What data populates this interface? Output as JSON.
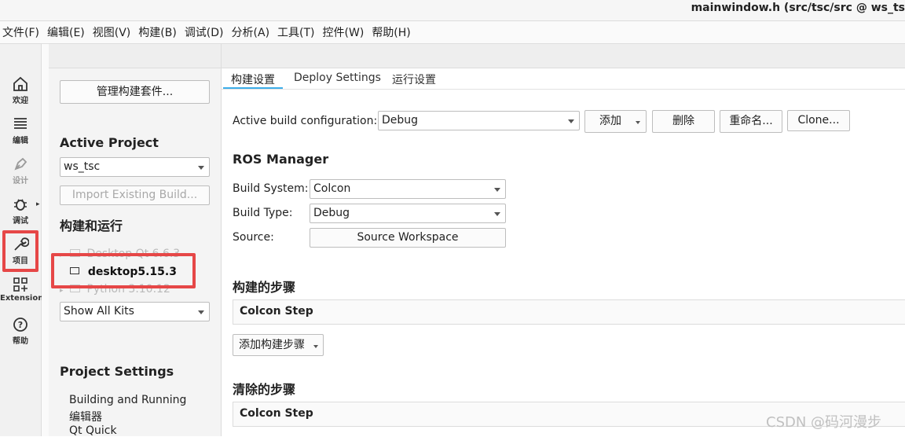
{
  "window": {
    "title": "mainwindow.h (src/tsc/src @ ws_ts"
  },
  "menu": [
    "文件(F)",
    "编辑(E)",
    "视图(V)",
    "构建(B)",
    "调试(D)",
    "分析(A)",
    "工具(T)",
    "控件(W)",
    "帮助(H)"
  ],
  "modes": [
    {
      "label": "欢迎",
      "icon": "home-icon"
    },
    {
      "label": "编辑",
      "icon": "text-lines-icon"
    },
    {
      "label": "设计",
      "icon": "pen-icon"
    },
    {
      "label": "调试",
      "icon": "bug-icon"
    },
    {
      "label": "项目",
      "icon": "wrench-icon"
    },
    {
      "label": "Extensions",
      "icon": "extensions-grid-icon"
    },
    {
      "label": "帮助",
      "icon": "help-circle-icon"
    }
  ],
  "left_pane": {
    "manage_kits_button": "管理构建套件...",
    "active_project_heading": "Active Project",
    "project_combo": "ws_tsc",
    "import_button": "Import Existing Build...",
    "build_run_heading": "构建和运行",
    "kits": [
      {
        "label": "Desktop Qt 6.6.3",
        "state": "faded"
      },
      {
        "label": "desktop5.15.3",
        "state": "selected"
      },
      {
        "label": "Python 3.10.12",
        "state": "faded"
      }
    ],
    "kit_filter_combo": "Show All Kits",
    "project_settings_heading": "Project Settings",
    "settings_items": [
      "Building and Running",
      "编辑器",
      "Qt Quick"
    ]
  },
  "tabs": [
    "构建设置",
    "Deploy Settings",
    "运行设置"
  ],
  "build_settings": {
    "active_config_label": "Active build configuration:",
    "active_config_value": "Debug",
    "add_button": "添加",
    "delete_button": "删除",
    "rename_button": "重命名...",
    "clone_button": "Clone...",
    "ros_heading": "ROS Manager",
    "build_system_label": "Build System:",
    "build_system_value": "Colcon",
    "build_type_label": "Build Type:",
    "build_type_value": "Debug",
    "source_label": "Source:",
    "source_button": "Source Workspace",
    "build_steps_heading": "构建的步骤",
    "build_step_name": "Colcon Step",
    "add_build_step_button": "添加构建步骤",
    "clean_steps_heading": "清除的步骤",
    "clean_step_name": "Colcon Step"
  },
  "watermark": "CSDN @码河漫步",
  "colors": {
    "highlight_red": "#e64747",
    "tab_accent": "#3daee9"
  }
}
